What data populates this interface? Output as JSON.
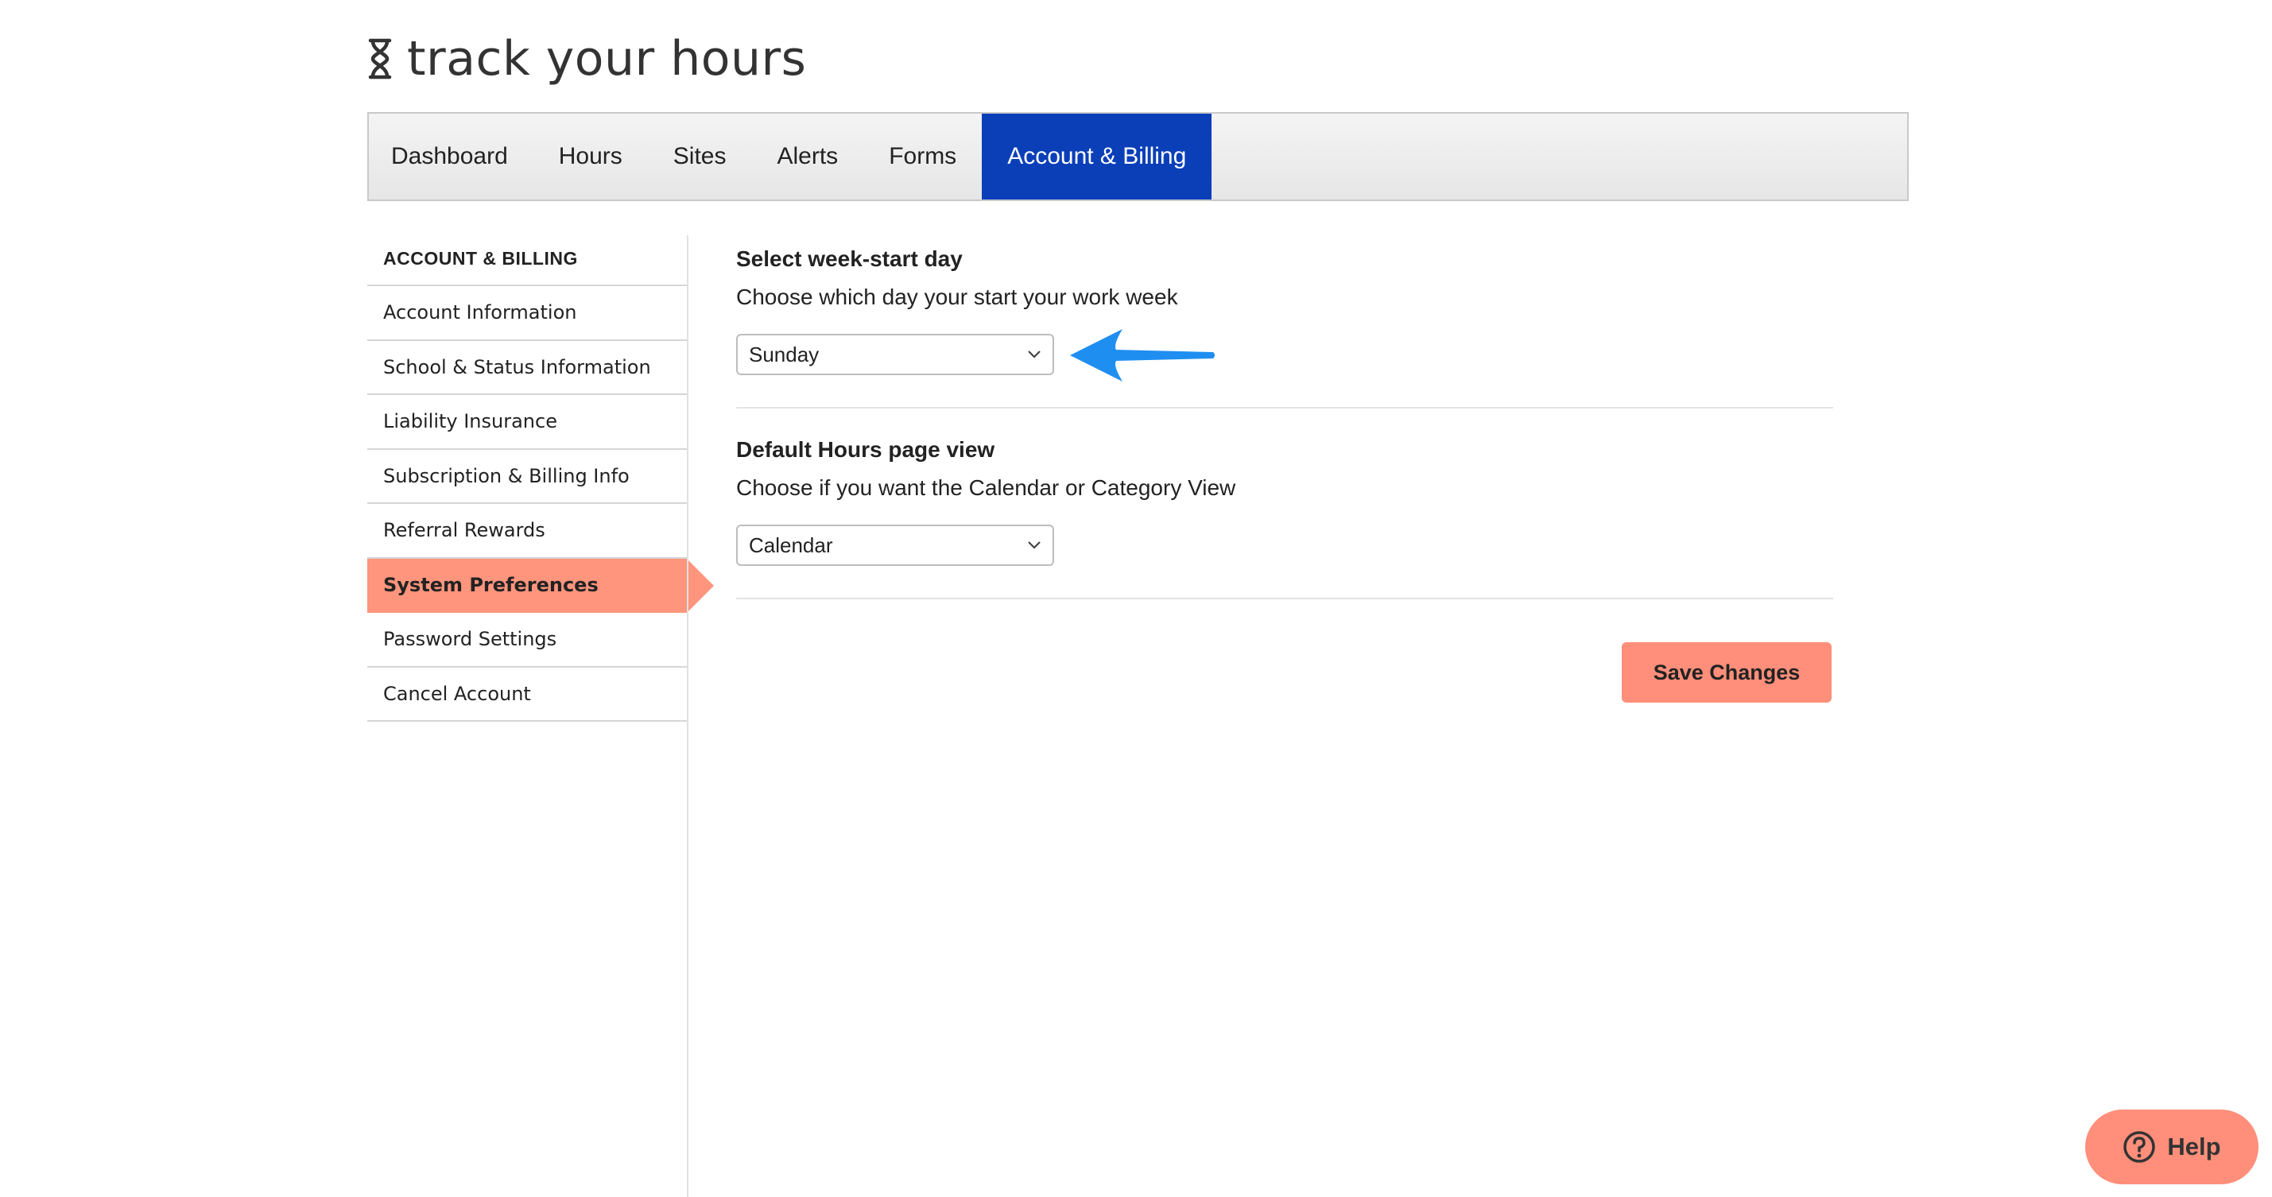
{
  "brand": {
    "name": "track your hours",
    "logo_icon": "hourglass-icon"
  },
  "nav": {
    "tabs": [
      {
        "label": "Dashboard"
      },
      {
        "label": "Hours"
      },
      {
        "label": "Sites"
      },
      {
        "label": "Alerts"
      },
      {
        "label": "Forms"
      },
      {
        "label": "Account & Billing",
        "active": true
      }
    ],
    "active_color": "#0a3fb8"
  },
  "sidebar": {
    "heading": "ACCOUNT & BILLING",
    "items": [
      {
        "label": "Account Information"
      },
      {
        "label": "School & Status Information"
      },
      {
        "label": "Liability Insurance"
      },
      {
        "label": "Subscription & Billing Info"
      },
      {
        "label": "Referral Rewards"
      },
      {
        "label": "System Preferences",
        "active": true
      },
      {
        "label": "Password Settings"
      },
      {
        "label": "Cancel Account"
      }
    ],
    "active_color": "#ff957d"
  },
  "preferences": {
    "week_start": {
      "title": "Select week-start day",
      "description": "Choose which day your start your work week",
      "selected": "Sunday"
    },
    "hours_view": {
      "title": "Default Hours page view",
      "description": "Choose if you want the Calendar or Category View",
      "selected": "Calendar"
    },
    "save_label": "Save Changes"
  },
  "annotation": {
    "arrow_color": "#1f8ef1",
    "icon": "arrow-left-icon"
  },
  "help": {
    "label": "Help",
    "icon": "question-circle-icon"
  }
}
